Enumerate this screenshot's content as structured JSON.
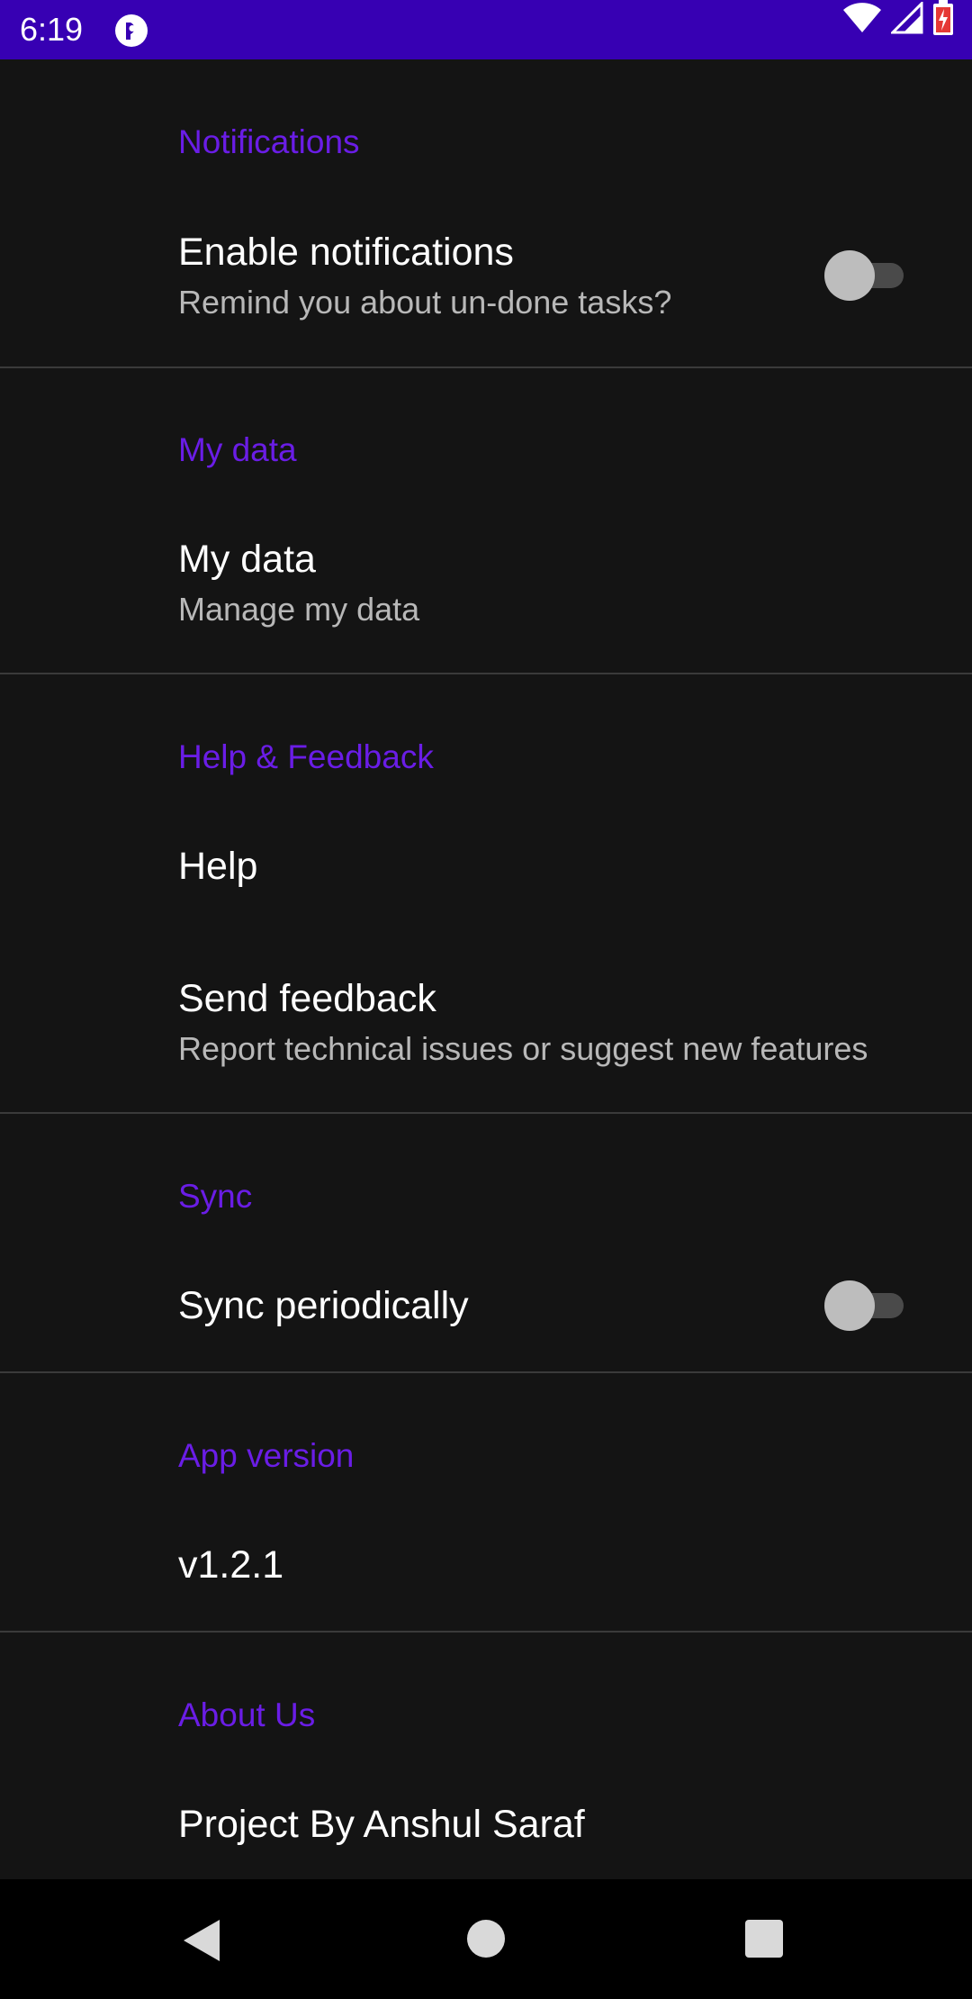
{
  "status_bar": {
    "time": "6:19",
    "app_icon": "pocket-casts-like-icon",
    "icons": [
      "wifi-icon",
      "signal-icon",
      "battery-charging-icon"
    ],
    "background_color": "#3700b3"
  },
  "colors": {
    "accent": "#6a1de6",
    "background": "#141414",
    "title": "#ffffff",
    "summary": "#b8b8b8"
  },
  "sections": {
    "notifications": {
      "header": "Notifications",
      "enable": {
        "title": "Enable notifications",
        "summary": "Remind you about un-done tasks?",
        "checked": false
      }
    },
    "my_data": {
      "header": "My data",
      "item": {
        "title": "My data",
        "summary": "Manage my data"
      }
    },
    "help_feedback": {
      "header": "Help & Feedback",
      "help": {
        "title": "Help"
      },
      "feedback": {
        "title": "Send feedback",
        "summary": "Report technical issues or suggest new features"
      }
    },
    "sync": {
      "header": "Sync",
      "periodic": {
        "title": "Sync periodically",
        "checked": false
      }
    },
    "app_version": {
      "header": "App version",
      "value": "v1.2.1"
    },
    "about": {
      "header": "About Us",
      "value": "Project By Anshul Saraf"
    }
  },
  "nav_bar": {
    "buttons": [
      "back-icon",
      "home-icon",
      "recents-icon"
    ]
  }
}
